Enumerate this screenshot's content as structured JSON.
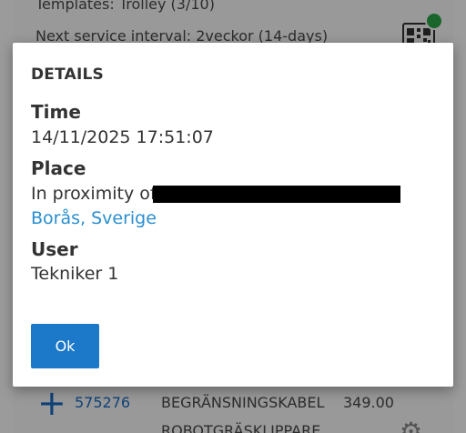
{
  "background": {
    "templates_text": "Templates: Trolley (3/10)",
    "next_service_text": "Next service interval: 2veckor (14-days)",
    "list_row": {
      "id": "575276",
      "name": "BEGRÄNSNINGSKABEL",
      "price": "349.00"
    },
    "list_row_2_name": "ROBOTGRÄSKLIPPARE",
    "status_color": "#2aa84a"
  },
  "dialog": {
    "title": "DETAILS",
    "time_label": "Time",
    "time_value": "14/11/2025 17:51:07",
    "place_label": "Place",
    "place_prefix": "In proximity of",
    "place_city": "Borås, Sverige",
    "user_label": "User",
    "user_value": "Tekniker 1",
    "ok_label": "Ok",
    "accent_color": "#1c78c9",
    "link_color": "#2a8fd0"
  }
}
